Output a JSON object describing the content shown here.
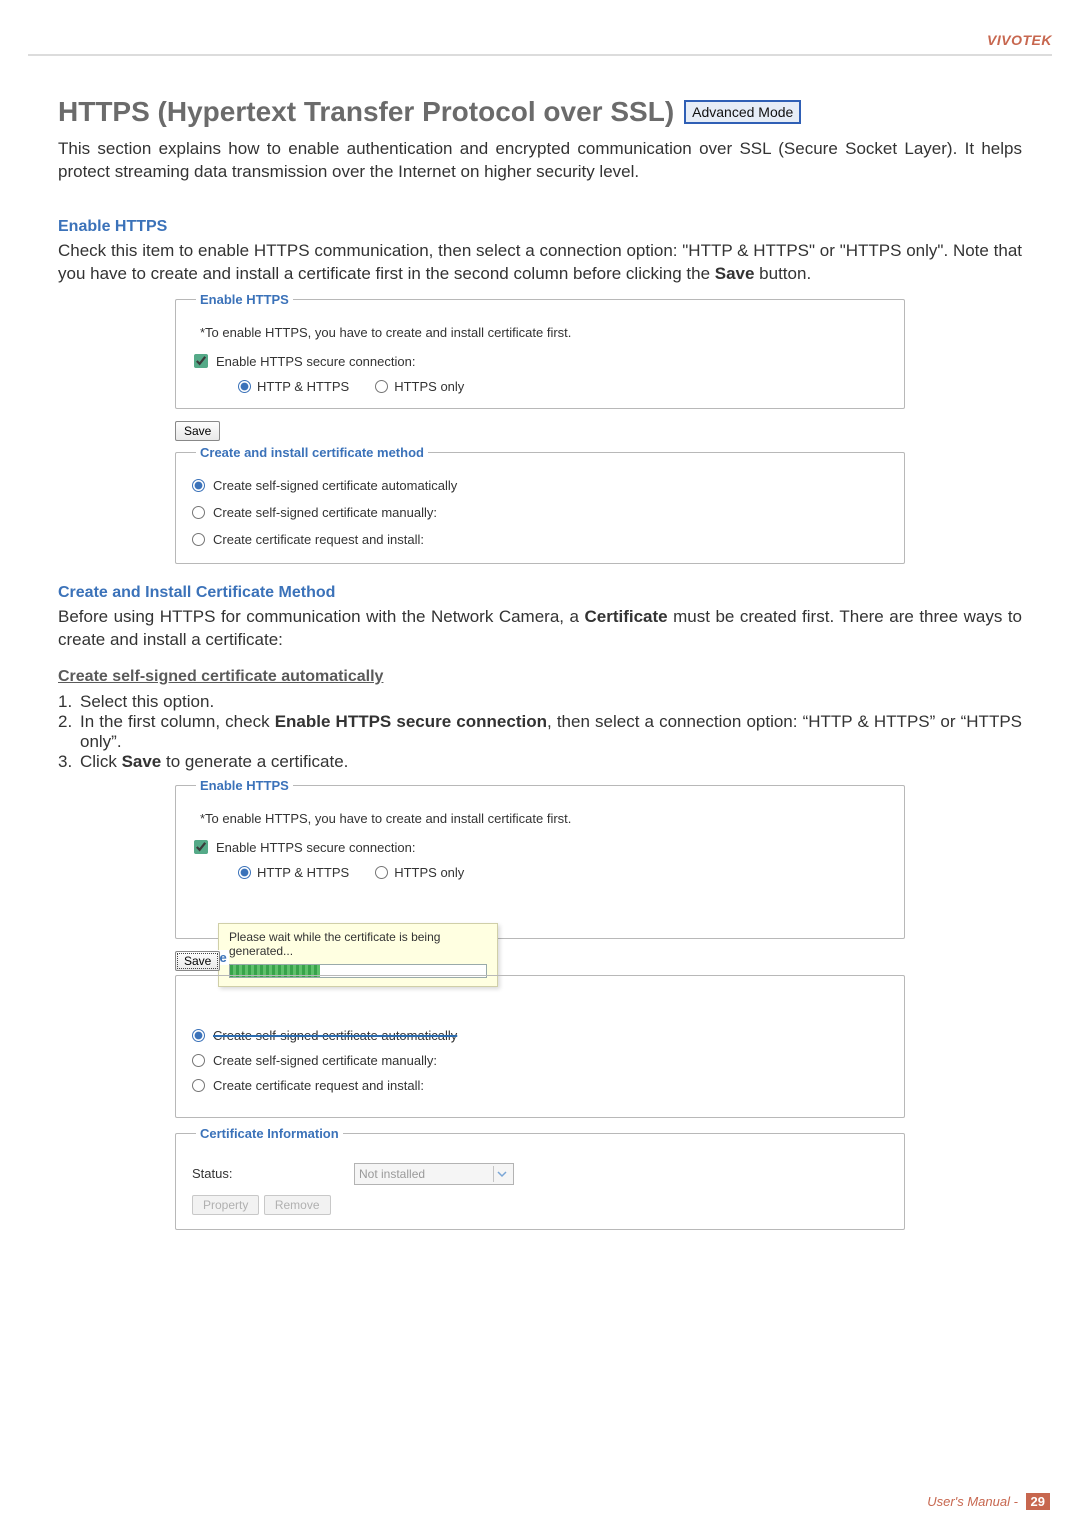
{
  "brand": "VIVOTEK",
  "title": "HTTPS (Hypertext Transfer Protocol over SSL)",
  "mode_badge": "Advanced Mode",
  "intro": "This section explains how to enable authentication and encrypted communication over SSL (Secure Socket Layer). It helps protect streaming data transmission over the Internet on higher security level.",
  "section1": {
    "heading": "Enable HTTPS",
    "text_pre": "Check this item to enable HTTPS communication, then select a connection option: \"HTTP & HTTPS\" or \"HTTPS only\". Note that you have to create and install a certificate first in the second column before clicking the ",
    "text_bold": "Save",
    "text_post": " button."
  },
  "enable_panel": {
    "legend": "Enable HTTPS",
    "note": "*To enable HTTPS, you have to create and install certificate first.",
    "checkbox_label": "Enable HTTPS secure connection:",
    "opt1": "HTTP & HTTPS",
    "opt2": "HTTPS only",
    "save": "Save"
  },
  "cert_panel": {
    "legend": "Create and install certificate method",
    "opt_auto": "Create self-signed certificate automatically",
    "opt_manual": "Create self-signed certificate manually:",
    "opt_request": "Create certificate request and install:"
  },
  "section2": {
    "heading": "Create and Install Certificate Method",
    "para_pre": "Before using HTTPS for communication with the Network Camera, a ",
    "para_bold": "Certificate",
    "para_post": " must be created first. There are three ways to create and install a certificate:",
    "sub_heading": "Create self-signed certificate automatically",
    "steps": {
      "s1": "Select this option.",
      "s2_pre": "In the first column, check ",
      "s2_bold": "Enable HTTPS secure connection",
      "s2_post": ", then select a connection option: “HTTP & HTTPS” or “HTTPS only”.",
      "s3_pre": "Click ",
      "s3_bold": "Save",
      "s3_post": " to generate a certificate."
    }
  },
  "progress_msg": "Please wait while the certificate is being generated...",
  "clip_label": "Cre",
  "certinfo": {
    "legend": "Certificate Information",
    "status_label": "Status:",
    "status_value": "Not installed",
    "property": "Property",
    "remove": "Remove"
  },
  "footer": {
    "text": "User's Manual -",
    "page": "29"
  }
}
